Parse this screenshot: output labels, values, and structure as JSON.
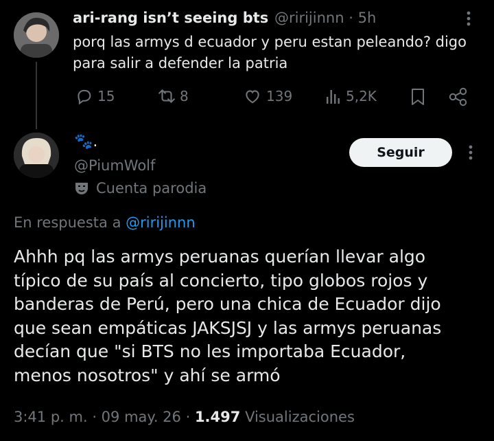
{
  "tweet1": {
    "display_name": "ari-rang isn’t seeing bts",
    "handle": "@ririjinnn",
    "separator": "·",
    "time": "5h",
    "text_line1": "porq las armys d ecuador y peru estan peleando? digo",
    "text_line2": "para salir a defender la patria",
    "replies": "15",
    "reposts": "8",
    "likes": "139",
    "views": "5,2K",
    "icons": [
      "reply-icon",
      "repost-icon",
      "like-icon",
      "views-icon",
      "bookmark-icon",
      "share-icon"
    ]
  },
  "tweet2": {
    "display_name": "🐾.",
    "handle": "@PiumWolf",
    "parody_label": "Cuenta parodia",
    "follow_label": "Seguir",
    "reply_prefix": "En respuesta a",
    "reply_to": "@ririjinnn",
    "text_lines": [
      "Ahhh pq las armys peruanas querían llevar algo",
      "típico de su país al concierto, tipo globos rojos y",
      "banderas de Perú, pero una chica de Ecuador dijo",
      "que sean empáticas JAKSJSJ y las armys peruanas",
      "decían que \"si BTS no les importaba Ecuador,",
      "menos nosotros\" y ahí se armó"
    ],
    "timestamp": "3:41 p. m. · 09 may. 26 ·",
    "view_count": "1.497",
    "view_label": "Visualizaciones"
  },
  "colors": {
    "background": "#000000",
    "text": "#e7e9ea",
    "muted": "#71767b",
    "link": "#1d9bf0",
    "button": "#eff3f4"
  }
}
